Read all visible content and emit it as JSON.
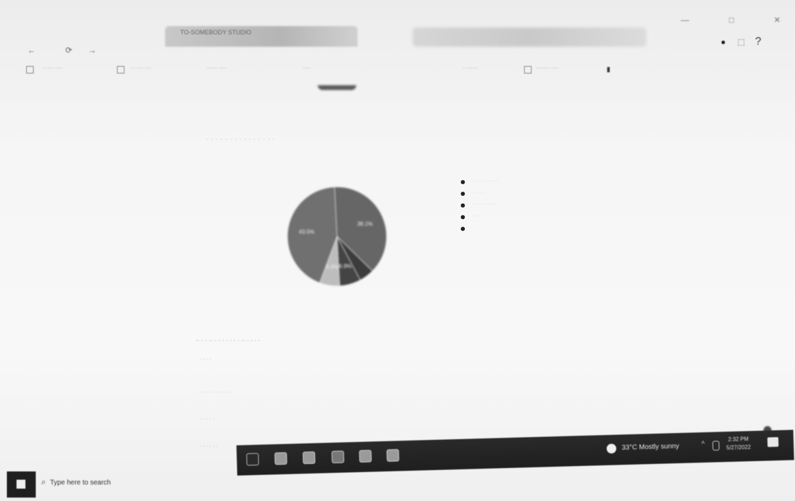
{
  "browser": {
    "tab_title": "TO-SOMEBODY STUDIO",
    "window_controls": [
      "—",
      "□",
      "✕"
    ],
    "nav": {
      "back": "←",
      "reload": "⟳",
      "forward": "→"
    },
    "profile_icons": [
      "●",
      "⬚",
      "?"
    ],
    "bookmarks": [
      "·· ···· ·····",
      "·· ····· ····",
      "······· ·····",
      "·····",
      "·· ·······",
      "········ ·····"
    ]
  },
  "page": {
    "heading": "· · ·  ·  · · · ·  · · · · · · ·",
    "legend": [
      {
        "label": "· · · · · ·  · · ·",
        "color": "#2f2f2f"
      },
      {
        "label": "· · · ·",
        "color": "#2f2f2f"
      },
      {
        "label": "· · · · ·  · · ·",
        "color": "#2f2f2f"
      },
      {
        "label": "· ·",
        "color": "#2f2f2f"
      },
      {
        "label": "",
        "color": "#2f2f2f"
      }
    ],
    "section_title": "·· · · ·· · · · · ·  · · ·· · · · ·",
    "section_lines": [
      "· · · ·",
      "· · · · · · · · · ·",
      "· · · · ·",
      "· · · · · ·"
    ]
  },
  "chart_data": {
    "type": "pie",
    "series": [
      {
        "name": "",
        "label": "38.1%",
        "values": [
          38.1
        ],
        "color": "#666666"
      },
      {
        "name": "",
        "label": "",
        "values": [
          4.9
        ],
        "color": "#3c3c3c"
      },
      {
        "name": "",
        "label": "6.9%",
        "values": [
          6.9
        ],
        "color": "#444444"
      },
      {
        "name": "",
        "label": "6.6%",
        "values": [
          6.6
        ],
        "color": "#bdbdbd"
      },
      {
        "name": "",
        "label": "43.5%",
        "values": [
          43.5
        ],
        "color": "#707070"
      }
    ]
  },
  "taskbar": {
    "search_placeholder": "Type here to search",
    "weather": "33°C  Mostly sunny",
    "time": "2:32 PM",
    "date": "5/27/2022",
    "chevron": "^"
  }
}
